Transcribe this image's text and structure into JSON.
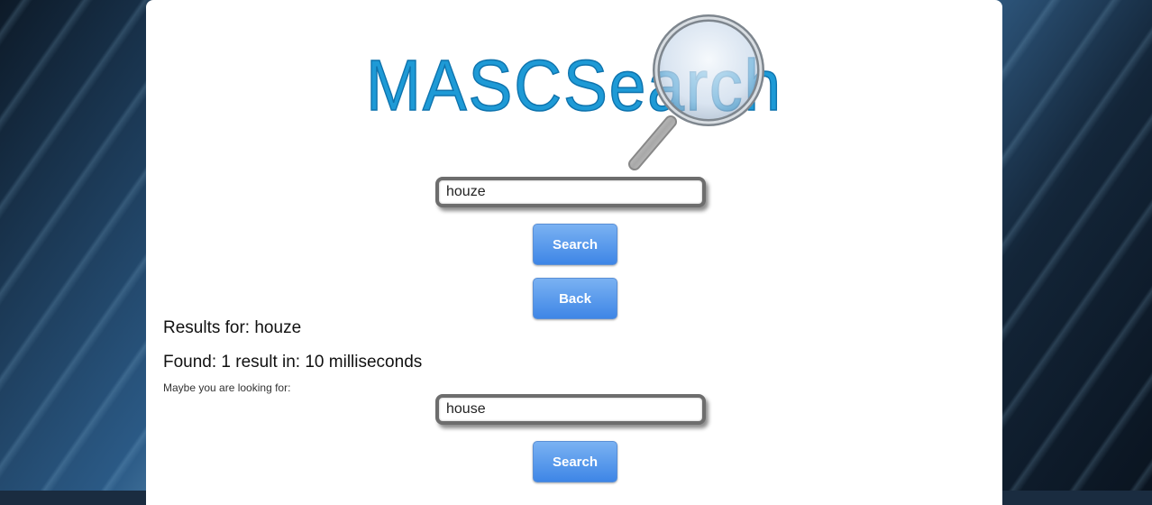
{
  "logo": {
    "text": "MASCSearch",
    "colors": {
      "primary": "#1e9ad6",
      "lens_ring": "#9aa0a6"
    }
  },
  "search": {
    "value": "houze",
    "button_label": "Search"
  },
  "back_button_label": "Back",
  "results": {
    "results_for": "Results for: houze",
    "found": "Found: 1 result in: 10 milliseconds",
    "suggestion_label": "Maybe you are looking for:"
  },
  "suggestion": {
    "value": "house",
    "button_label": "Search"
  },
  "colors": {
    "button_top": "#7ab2f2",
    "button_bottom": "#3e86e6"
  }
}
